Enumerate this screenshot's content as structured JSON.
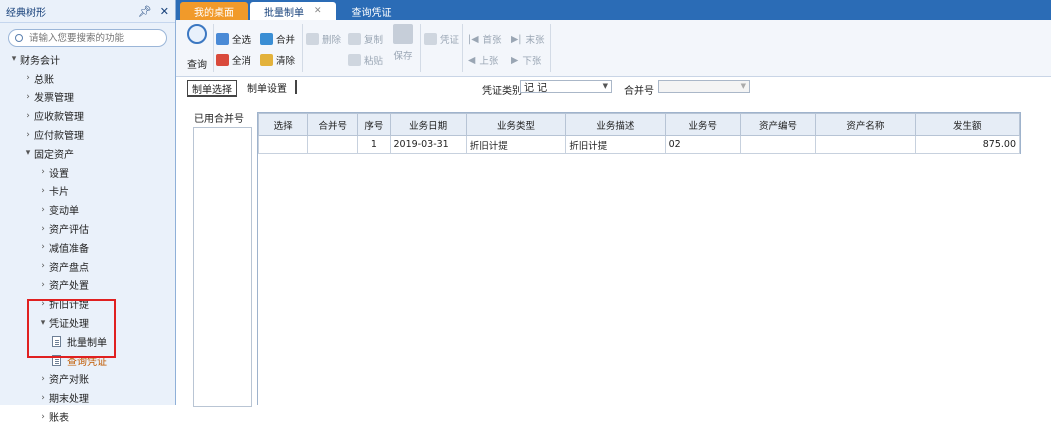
{
  "sidebar": {
    "title": "经典树形",
    "search_placeholder": "请输入您要搜索的功能",
    "items": [
      {
        "label": "财务会计"
      },
      {
        "label": "总账"
      },
      {
        "label": "发票管理"
      },
      {
        "label": "应收款管理"
      },
      {
        "label": "应付款管理"
      },
      {
        "label": "固定资产"
      },
      {
        "label": "设置"
      },
      {
        "label": "卡片"
      },
      {
        "label": "变动单"
      },
      {
        "label": "资产评估"
      },
      {
        "label": "减值准备"
      },
      {
        "label": "资产盘点"
      },
      {
        "label": "资产处置"
      },
      {
        "label": "折旧计提"
      },
      {
        "label": "凭证处理"
      },
      {
        "label": "批量制单"
      },
      {
        "label": "查询凭证"
      },
      {
        "label": "资产对账"
      },
      {
        "label": "期末处理"
      },
      {
        "label": "账表"
      }
    ]
  },
  "tabs": [
    {
      "label": "我的桌面"
    },
    {
      "label": "批量制单"
    },
    {
      "label": "查询凭证"
    }
  ],
  "toolbar": {
    "query": "查询",
    "select_all": "全选",
    "deselect_all": "全消",
    "merge": "合并",
    "clear": "清除",
    "delete": "删除",
    "copy": "复制",
    "paste": "粘贴",
    "save": "保存",
    "voucher": "凭证",
    "first": "首张",
    "last": "末张",
    "prev": "上张",
    "next": "下张"
  },
  "subtabs": {
    "selection": "制单选择",
    "settings": "制单设置"
  },
  "filters": {
    "voucher_type_label": "凭证类别",
    "voucher_type_value": "记 记",
    "merge_no_label": "合并号",
    "merge_no_value": ""
  },
  "used_merge_label": "已用合并号",
  "grid": {
    "columns": [
      "选择",
      "合并号",
      "序号",
      "业务日期",
      "业务类型",
      "业务描述",
      "业务号",
      "资产编号",
      "资产名称",
      "发生额"
    ],
    "rows": [
      [
        "",
        "",
        "1",
        "2019-03-31",
        "折旧计提",
        "折旧计提",
        "02",
        "",
        "",
        "875.00"
      ]
    ]
  },
  "colors": {
    "tabbar": "#2b6cb6",
    "tab_orange": "#f19a2a",
    "highlight_box": "#e02020",
    "active_item": "#c05a00"
  }
}
